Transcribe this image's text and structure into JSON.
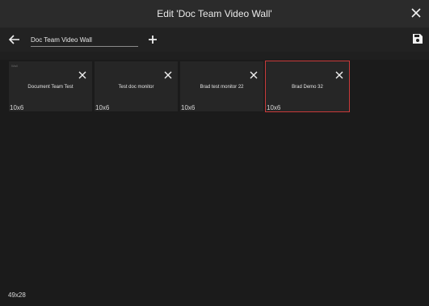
{
  "window": {
    "title": "Edit 'Doc Team Video Wall'"
  },
  "toolbar": {
    "name_value": "Doc Team Video Wall"
  },
  "tiles": [
    {
      "label": "Document Team Test",
      "size": "10x6",
      "tag": "Wall"
    },
    {
      "label": "Test doc monitor",
      "size": "10x6"
    },
    {
      "label": "Brad test monitor 22",
      "size": "10x6"
    },
    {
      "label": "Brad Demo 32",
      "size": "10x6"
    }
  ],
  "canvas": {
    "grid_size": "49x28"
  },
  "icons": {
    "close": "close-icon",
    "back": "arrow-left-icon",
    "add": "plus-icon",
    "save": "floppy-disk-icon",
    "tile_remove": "close-icon"
  },
  "colors": {
    "selected_border": "#c93a3a",
    "background": "#1b1b1b",
    "titlebar": "#2b2b2b"
  }
}
